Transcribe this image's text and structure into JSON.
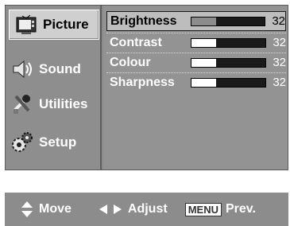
{
  "menu": {
    "items": [
      {
        "label": "Picture",
        "icon": "tv-picture-icon",
        "selected": true
      },
      {
        "label": "Sound",
        "icon": "speaker-icon",
        "selected": false
      },
      {
        "label": "Utilities",
        "icon": "tools-icon",
        "selected": false
      },
      {
        "label": "Setup",
        "icon": "gears-icon",
        "selected": false
      }
    ]
  },
  "settings": [
    {
      "label": "Brightness",
      "value": "32",
      "level": 0.33,
      "selected": true
    },
    {
      "label": "Contrast",
      "value": "32",
      "level": 0.33,
      "selected": false
    },
    {
      "label": "Colour",
      "value": "32",
      "level": 0.33,
      "selected": false
    },
    {
      "label": "Sharpness",
      "value": "32",
      "level": 0.33,
      "selected": false
    }
  ],
  "hints": {
    "move_label": "Move",
    "adjust_label": "Adjust",
    "menu_key": "MENU",
    "prev_label": "Prev."
  },
  "colors": {
    "osd_background": "#8c8c8c",
    "selected_highlight": "#cfcfcf",
    "bar_fill": "#ffffff",
    "bar_track": "#1a1a1a"
  }
}
